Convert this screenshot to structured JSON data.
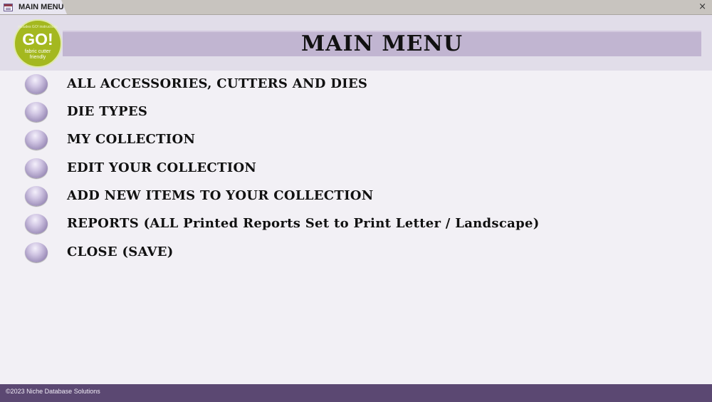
{
  "tab": {
    "label": "MAIN MENU",
    "icon": "form-icon"
  },
  "window": {
    "close_label": "×"
  },
  "logo": {
    "small_text": "includes GO! instructions",
    "main_text": "GO!",
    "line1": "fabric cutter",
    "line2": "friendly",
    "color": "#a4b81f"
  },
  "header": {
    "title": "MAIN MENU",
    "bar_color": "#c1b5d1"
  },
  "menu": {
    "items": [
      {
        "label": "ALL ACCESSORIES, CUTTERS AND DIES"
      },
      {
        "label": "DIE TYPES"
      },
      {
        "label": "MY COLLECTION"
      },
      {
        "label": "EDIT YOUR COLLECTION"
      },
      {
        "label": "ADD NEW ITEMS TO YOUR COLLECTION"
      },
      {
        "label": "REPORTS (ALL Printed Reports Set to Print Letter / Landscape)"
      },
      {
        "label": "CLOSE (SAVE)"
      }
    ]
  },
  "footer": {
    "copyright": "©2023 Niche Database Solutions",
    "color": "#5b4872"
  }
}
